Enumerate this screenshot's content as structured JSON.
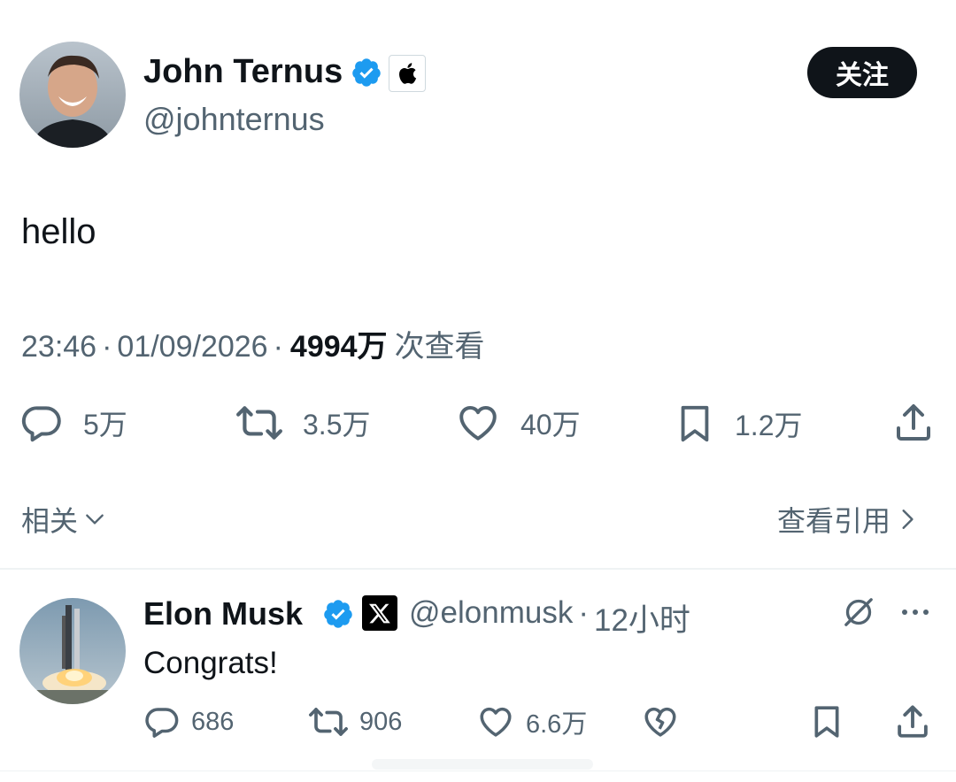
{
  "tweet": {
    "author_name": "John Ternus",
    "author_handle": "@johnternus",
    "follow_label": "关注",
    "text": "hello",
    "time": "23:46",
    "separator": "·",
    "date": "01/09/2026",
    "views_count": "4994万",
    "views_suffix": "次查看",
    "stats": {
      "replies": "5万",
      "retweets": "3.5万",
      "likes": "40万",
      "bookmarks": "1.2万"
    }
  },
  "related": {
    "label": "相关",
    "view_quotes_label": "查看引用"
  },
  "reply": {
    "author_name": "Elon Musk",
    "author_handle": "@elonmusk",
    "separator": "·",
    "time_ago": "12小时",
    "text": "Congrats!",
    "stats": {
      "replies": "686",
      "retweets": "906",
      "likes": "6.6万"
    }
  },
  "colors": {
    "verified_blue": "#1d9bf0",
    "text_primary": "#0f1419",
    "text_secondary": "#536471",
    "follow_bg": "#0f1419"
  },
  "icons": [
    "verified-badge-icon",
    "apple-logo-icon",
    "x-logo-icon",
    "reply-icon",
    "retweet-icon",
    "like-icon",
    "bookmark-icon",
    "share-icon",
    "chevron-down-icon",
    "chevron-right-icon",
    "grok-icon",
    "more-icon",
    "broken-heart-icon"
  ]
}
